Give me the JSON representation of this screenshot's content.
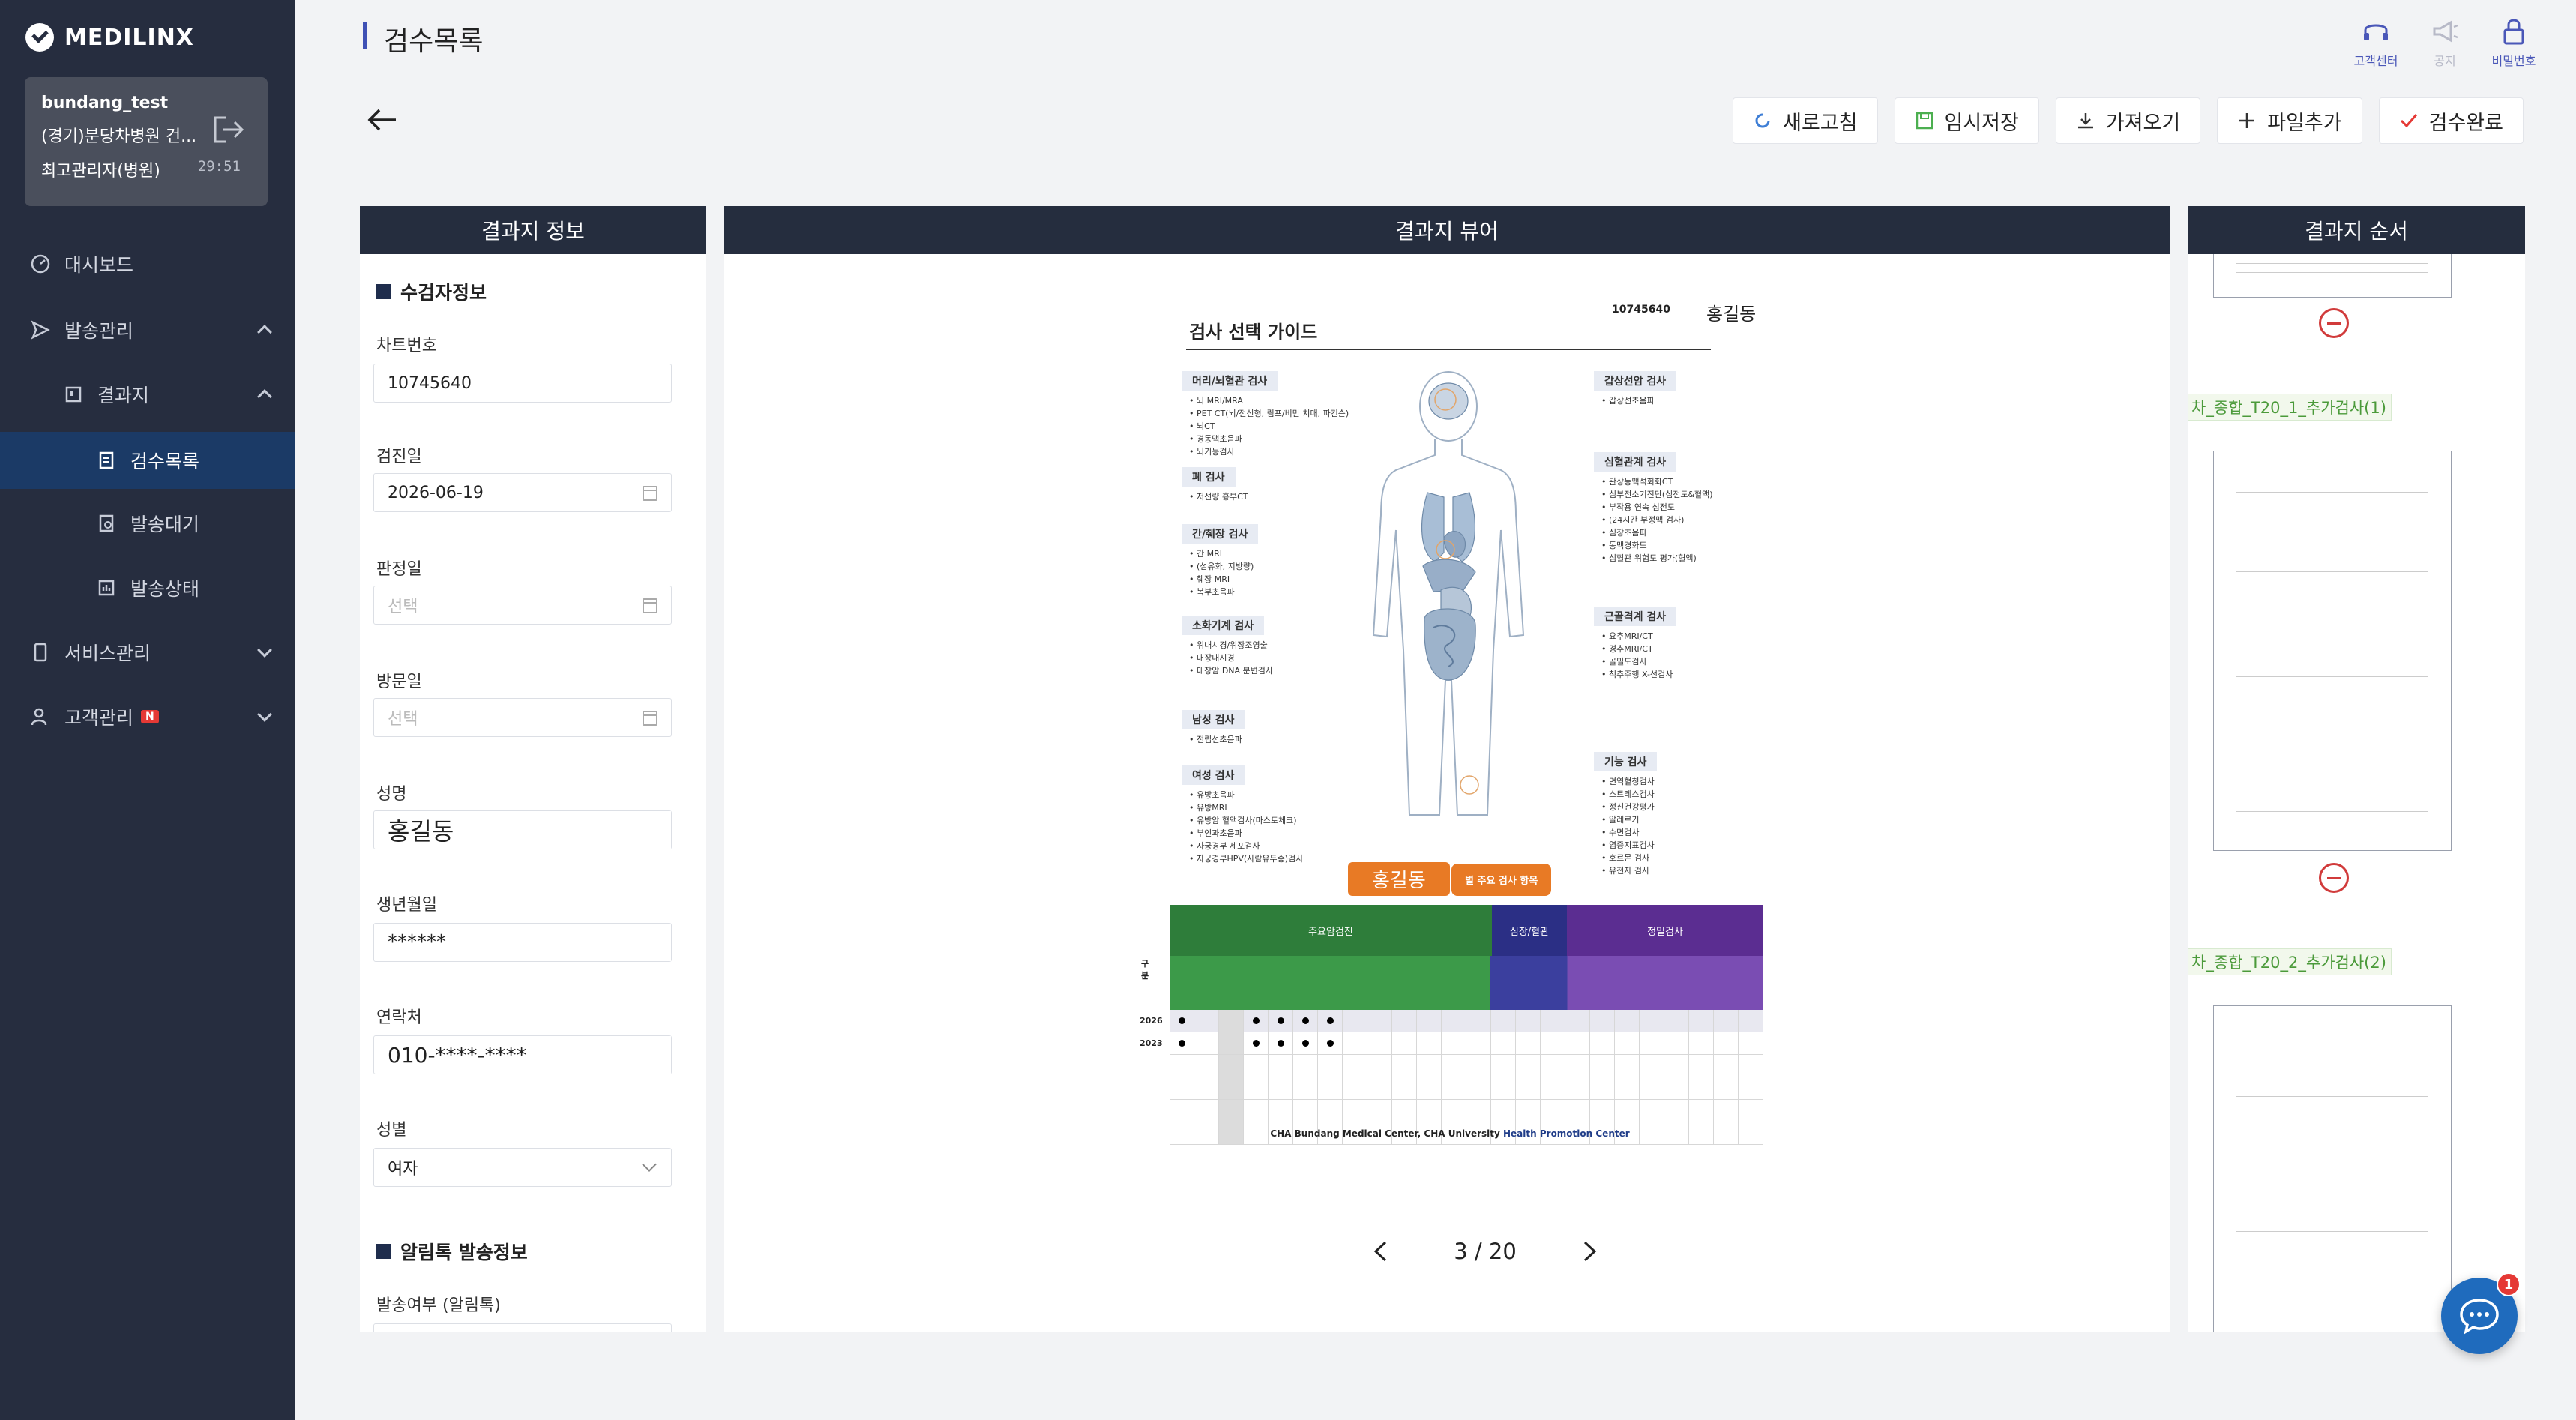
{
  "app": {
    "logo_text": "MEDILINX"
  },
  "user": {
    "id": "bundang_test",
    "org": "(경기)분당차병원 건...",
    "role": "최고관리자(병원)",
    "timer": "29:51"
  },
  "sidebar": {
    "items": [
      {
        "label": "대시보드",
        "icon": "dashboard-icon"
      },
      {
        "label": "발송관리",
        "icon": "send-icon"
      },
      {
        "label": "결과지",
        "icon": "result-icon"
      },
      {
        "label": "검수목록",
        "icon": "inspect-list-icon"
      },
      {
        "label": "발송대기",
        "icon": "send-wait-icon"
      },
      {
        "label": "발송상태",
        "icon": "send-status-icon"
      },
      {
        "label": "서비스관리",
        "icon": "service-icon"
      },
      {
        "label": "고객관리",
        "icon": "customer-icon",
        "badge": "N"
      }
    ]
  },
  "header": {
    "title": "검수목록",
    "icons": [
      {
        "label": "고객센터",
        "icon": "headset-icon"
      },
      {
        "label": "공지",
        "icon": "megaphone-icon"
      },
      {
        "label": "비밀번호",
        "icon": "lock-icon"
      }
    ]
  },
  "toolbar": {
    "refresh": "새로고침",
    "temp_save": "임시저장",
    "import": "가져오기",
    "add_file": "파일추가",
    "complete": "검수완료"
  },
  "info_panel": {
    "title": "결과지 정보",
    "section_patient": "수검자정보",
    "chart_no_label": "차트번호",
    "chart_no": "10745640",
    "exam_date_label": "검진일",
    "exam_date": "2026-06-19",
    "judge_date_label": "판정일",
    "judge_date_placeholder": "선택",
    "visit_date_label": "방문일",
    "visit_date_placeholder": "선택",
    "name_label": "성명",
    "name": "홍길동",
    "birth_label": "생년월일",
    "birth": "******",
    "phone_label": "연락처",
    "phone": "010-****-****",
    "gender_label": "성별",
    "gender": "여자",
    "section_alimtalk": "알림톡 발송정보",
    "send_yn_label": "발송여부 (알림톡)"
  },
  "viewer": {
    "title": "결과지 뷰어",
    "doc": {
      "chart_no": "10745640",
      "patient": "홍길동",
      "title": "검사 선택 가이드",
      "categories_left": [
        {
          "head": "머리/뇌혈관 검사",
          "items": [
            "뇌 MRI/MRA",
            "PET CT(뇌/전신형, 림프/비만 치매, 파킨슨)",
            "뇌CT",
            "경동맥초음파",
            "뇌기능검사"
          ]
        },
        {
          "head": "폐 검사",
          "items": [
            "저선량 흉부CT"
          ]
        },
        {
          "head": "간/췌장 검사",
          "items": [
            "간 MRI",
            "(섬유화, 지방량)",
            "췌장 MRI",
            "복부초음파"
          ]
        },
        {
          "head": "소화기계 검사",
          "items": [
            "위내시경/위장조영술",
            "대장내시경",
            "대장암 DNA 분변검사"
          ]
        },
        {
          "head": "남성 검사",
          "items": [
            "전립선초음파"
          ]
        },
        {
          "head": "여성 검사",
          "items": [
            "유방초음파",
            "유방MRI",
            "유방암 혈액검사(마스토체크)",
            "부인과초음파",
            "자궁경부 세포검사",
            "자궁경부HPV(사람유두종)검사"
          ]
        }
      ],
      "categories_right": [
        {
          "head": "갑상선암 검사",
          "items": [
            "갑상선초음파"
          ]
        },
        {
          "head": "심혈관계 검사",
          "items": [
            "관상동맥석회화CT",
            "심부전소기진단(심전도&혈액)",
            "부작용 연속 심전도",
            "(24시간 부정맥 검사)",
            "심장초음파",
            "동맥경화도",
            "심혈관 위험도 평가(혈액)"
          ]
        },
        {
          "head": "근골격계 검사",
          "items": [
            "요추MRI/CT",
            "경추MRI/CT",
            "골밀도검사",
            "척추주행 X-선검사"
          ]
        },
        {
          "head": "기능 검사",
          "items": [
            "면역혈청검사",
            "스트레스검사",
            "정신건강평가",
            "알레르기",
            "수면검사",
            "염증지표검사",
            "호르몬 검사",
            "유전자 검사"
          ]
        }
      ],
      "table_head_label": "별 주요 검사 항목",
      "table_groups": [
        "주요암검진",
        "심장/혈관",
        "정밀검사"
      ],
      "row_header": "구분",
      "row_years": [
        "2026",
        "2023"
      ],
      "footer_normal": "CHA Bundang Medical Center, CHA University ",
      "footer_bold": "Health Promotion Center"
    },
    "pager": {
      "current": "3",
      "total": "20",
      "text": "3 / 20"
    }
  },
  "order_panel": {
    "title": "결과지 순서",
    "items": [
      {
        "label": "차_종합_T20_1_추가검사(1)"
      },
      {
        "label": "차_종합_T20_2_추가검사(2)"
      }
    ]
  },
  "chat": {
    "badge": "1"
  }
}
